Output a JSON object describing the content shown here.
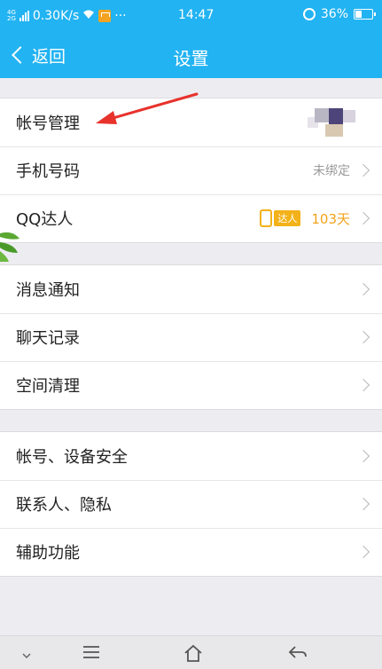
{
  "status_bar": {
    "net_type_top": "4G",
    "net_type_bottom": "2G",
    "speed": "0.30K/s",
    "dots": "···",
    "time": "14:47",
    "battery": "36%"
  },
  "nav": {
    "back_label": "返回",
    "title": "设置"
  },
  "groups": [
    {
      "rows": [
        {
          "label": "帐号管理",
          "value": "",
          "has_avatar": true
        },
        {
          "label": "手机号码",
          "value": "未绑定"
        },
        {
          "label": "QQ达人",
          "badge": "达人",
          "value": "103天"
        }
      ]
    },
    {
      "rows": [
        {
          "label": "消息通知"
        },
        {
          "label": "聊天记录"
        },
        {
          "label": "空间清理"
        }
      ]
    },
    {
      "rows": [
        {
          "label": "帐号、设备安全"
        },
        {
          "label": "联系人、隐私"
        },
        {
          "label": "辅助功能"
        }
      ]
    }
  ],
  "colors": {
    "brand": "#22b3f2",
    "annotation_arrow": "#e8322c",
    "badge": "#f3b21a"
  },
  "icons": [
    "signal-icon",
    "wifi-icon",
    "storage-icon",
    "alarm-icon",
    "battery-icon",
    "back-chevron-icon",
    "chevron-right-icon",
    "phone-vibrate-icon",
    "menu-icon",
    "home-icon",
    "back-icon",
    "chevron-down-icon"
  ]
}
